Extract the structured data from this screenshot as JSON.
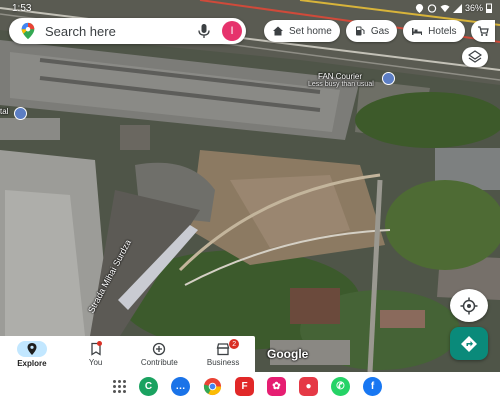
{
  "status_bar": {
    "time": "1:53",
    "battery": "36%"
  },
  "search": {
    "placeholder": "Search here"
  },
  "account": {
    "initial": "I",
    "color": "#e6336c"
  },
  "chips": [
    {
      "label": "Set home",
      "icon": "home-icon"
    },
    {
      "label": "Gas",
      "icon": "gas-station-icon"
    },
    {
      "label": "Hotels",
      "icon": "bed-icon"
    },
    {
      "label": "",
      "icon": "cart-icon"
    }
  ],
  "map": {
    "places": [
      {
        "name": "FAN Courier",
        "subtitle": "Less busy than usual"
      }
    ],
    "partial_label": "tal",
    "street": "Strada Mihai Surdza",
    "logo": "Google"
  },
  "bottom_nav": [
    {
      "label": "Explore",
      "icon": "explore-pin-icon",
      "active": true
    },
    {
      "label": "You",
      "icon": "bookmark-icon",
      "active": false,
      "dot": true
    },
    {
      "label": "Contribute",
      "icon": "add-circle-icon",
      "active": false
    },
    {
      "label": "Business",
      "icon": "storefront-icon",
      "active": false,
      "badge": "2"
    }
  ],
  "dock_apps": [
    {
      "name": "app-drawer-icon"
    },
    {
      "name": "chat-app-icon",
      "color": "#1aa260",
      "glyph": "C"
    },
    {
      "name": "messages-icon",
      "color": "#1a73e8",
      "glyph": "…"
    },
    {
      "name": "chrome-icon",
      "color": "#ea4335",
      "glyph": ""
    },
    {
      "name": "flipboard-icon",
      "color": "#e12828",
      "glyph": "F"
    },
    {
      "name": "flower-app-icon",
      "color": "#e61e72",
      "glyph": "✿"
    },
    {
      "name": "screen-recorder-icon",
      "color": "#e53946",
      "glyph": "●"
    },
    {
      "name": "whatsapp-icon",
      "color": "#25d366",
      "glyph": "✆"
    },
    {
      "name": "facebook-icon",
      "color": "#1877f2",
      "glyph": "f"
    }
  ],
  "colors": {
    "accent": "#0a8a7a",
    "active_nav": "#c2e7ff",
    "badge": "#d93025"
  }
}
